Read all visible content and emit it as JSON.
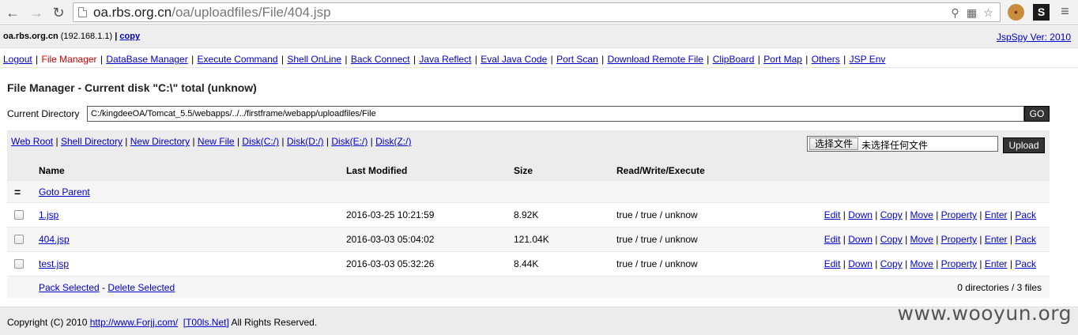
{
  "browser": {
    "url_host": "oa.rbs.org.cn",
    "url_path": "/oa/uploadfiles/File/404.jsp",
    "icons": [
      "back-icon",
      "forward-icon",
      "reload-icon",
      "page-icon",
      "key-icon",
      "translate-icon",
      "bookmark-star-icon",
      "cookie-extension-icon",
      "s-extension-icon",
      "menu-icon"
    ],
    "ext_s_label": "S"
  },
  "info": {
    "host": "oa.rbs.org.cn",
    "ip": "(192.168.1.1)",
    "sep": "|",
    "copy_label": "copy",
    "version": "JspSpy Ver: 2010"
  },
  "menu": [
    {
      "label": "Logout",
      "active": false
    },
    {
      "label": "File Manager",
      "active": true
    },
    {
      "label": "DataBase Manager",
      "active": false
    },
    {
      "label": "Execute Command",
      "active": false
    },
    {
      "label": "Shell OnLine",
      "active": false
    },
    {
      "label": "Back Connect",
      "active": false
    },
    {
      "label": "Java Reflect",
      "active": false
    },
    {
      "label": "Eval Java Code",
      "active": false
    },
    {
      "label": "Port Scan",
      "active": false
    },
    {
      "label": "Download Remote File",
      "active": false
    },
    {
      "label": "ClipBoard",
      "active": false
    },
    {
      "label": "Port Map",
      "active": false
    },
    {
      "label": "Others",
      "active": false
    },
    {
      "label": "JSP Env",
      "active": false
    }
  ],
  "title": "File Manager - Current disk \"C:\\\" total (unknow)",
  "current_dir": {
    "label": "Current Directory",
    "value": "C:/kingdeeOA/Tomcat_5.5/webapps/../../firstframe/webapp/uploadfiles/File",
    "go_label": "GO"
  },
  "toolbar": {
    "links": [
      "Web Root",
      "Shell Directory",
      "New Directory",
      "New File",
      "Disk(C:/)",
      "Disk(D:/)",
      "Disk(E:/)",
      "Disk(Z:/)"
    ],
    "choose_file": "选择文件",
    "no_file": "未选择任何文件",
    "upload_label": "Upload"
  },
  "table": {
    "headers": {
      "name": "Name",
      "modified": "Last Modified",
      "size": "Size",
      "rwx": "Read/Write/Execute"
    },
    "parent_icon": "=",
    "parent_label": "Goto Parent",
    "rows": [
      {
        "name": "1.jsp",
        "modified": "2016-03-25 10:21:59",
        "size": "8.92K",
        "rwx": "true / true / unknow"
      },
      {
        "name": "404.jsp",
        "modified": "2016-03-03 05:04:02",
        "size": "121.04K",
        "rwx": "true / true / unknow"
      },
      {
        "name": "test.jsp",
        "modified": "2016-03-03 05:32:26",
        "size": "8.44K",
        "rwx": "true / true / unknow"
      }
    ],
    "actions": [
      "Edit",
      "Down",
      "Copy",
      "Move",
      "Property",
      "Enter",
      "Pack"
    ],
    "pack_selected": "Pack Selected",
    "dash": "-",
    "delete_selected": "Delete Selected",
    "count": "0 directories / 3 files"
  },
  "footer": {
    "prefix": "Copyright (C) 2010",
    "link1": "http://www.Forjj.com/",
    "link2": "[T00ls.Net]",
    "suffix": "All Rights Reserved."
  },
  "watermark": "www.wooyun.org"
}
